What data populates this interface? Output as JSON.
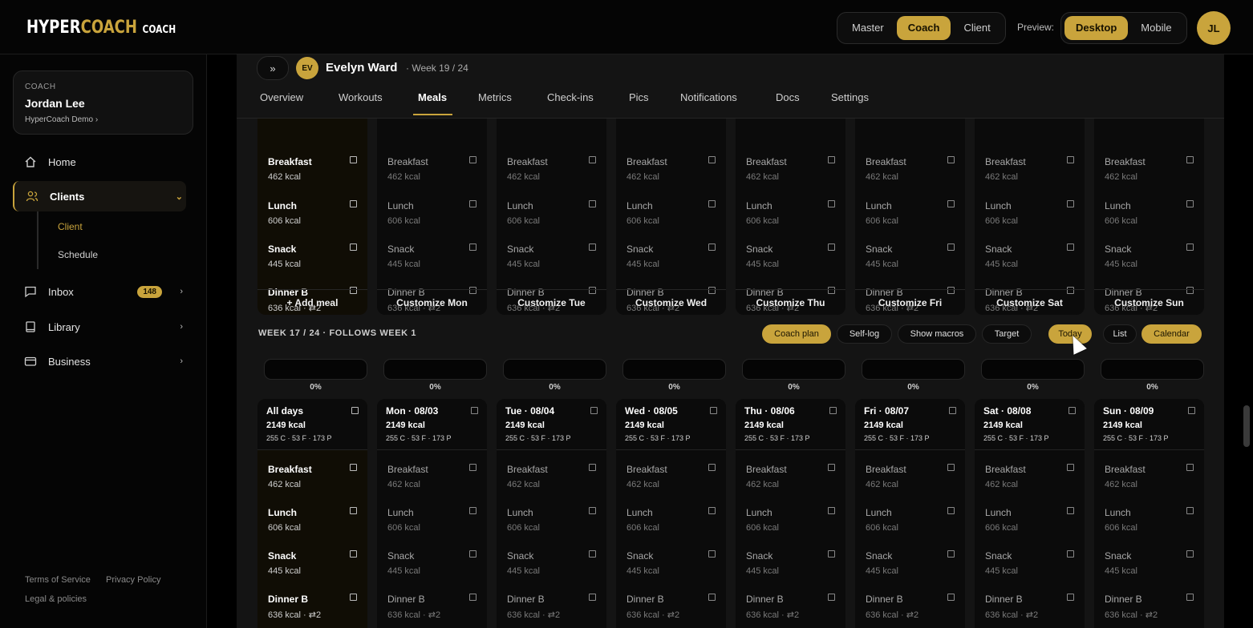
{
  "brand": {
    "name_white": "HYPER",
    "name_gold": "COACH",
    "tag": "COACH"
  },
  "modes": [
    "Master",
    "Coach",
    "Client"
  ],
  "active_mode": "Coach",
  "preview": {
    "label": "Preview:",
    "options": [
      "Desktop",
      "Mobile"
    ],
    "active": "Desktop"
  },
  "user": {
    "initials": "JL"
  },
  "coach_card": {
    "kicker": "COACH",
    "name": "Jordan Lee",
    "org": "HyperCoach Demo ›"
  },
  "sidebar": {
    "items": [
      {
        "label": "Home",
        "icon": "home-icon"
      },
      {
        "label": "Clients",
        "icon": "users-icon"
      },
      {
        "label": "Inbox",
        "icon": "chat-icon",
        "badge": "148"
      },
      {
        "label": "Library",
        "icon": "book-icon"
      },
      {
        "label": "Business",
        "icon": "card-icon"
      }
    ],
    "sub": [
      "Client",
      "Schedule"
    ],
    "footer": {
      "terms": "Terms of Service",
      "privacy": "Privacy Policy",
      "legal": "Legal & policies"
    }
  },
  "client": {
    "initials": "EV",
    "name": "Evelyn Ward",
    "week": "· Week 19 / 24",
    "expand": "»"
  },
  "tabs": [
    "Overview",
    "Workouts",
    "Meals",
    "Metrics",
    "Check-ins",
    "Pics",
    "Notifications",
    "Docs",
    "Settings"
  ],
  "active_tab": "Meals",
  "meals": [
    {
      "name": "Breakfast",
      "kcal": "462 kcal"
    },
    {
      "name": "Lunch",
      "kcal": "606 kcal"
    },
    {
      "name": "Snack",
      "kcal": "445 kcal"
    },
    {
      "name": "Dinner B",
      "kcal": "636 kcal · ⇄2"
    }
  ],
  "week1": {
    "buttons": [
      "+ Add meal",
      "Customize Mon",
      "Customize Tue",
      "Customize Wed",
      "Customize Thu",
      "Customize Fri",
      "Customize Sat",
      "Customize Sun"
    ]
  },
  "week2": {
    "label": "WEEK 17 / 24 · FOLLOWS WEEK 1",
    "toolbar": [
      "Coach plan",
      "Self-log",
      "Show macros",
      "Target",
      "Today",
      "List",
      "Calendar"
    ],
    "toolbar_active": [
      "Coach plan",
      "Today",
      "Calendar"
    ],
    "progress": [
      "0%",
      "0%",
      "0%",
      "0%",
      "0%",
      "0%",
      "0%",
      "0%"
    ],
    "days": [
      {
        "title": "All days",
        "kcal": "2149 kcal",
        "macros": "255 C · 53 F · 173 P"
      },
      {
        "title": "Mon · 08/03",
        "kcal": "2149 kcal",
        "macros": "255 C · 53 F · 173 P"
      },
      {
        "title": "Tue · 08/04",
        "kcal": "2149 kcal",
        "macros": "255 C · 53 F · 173 P"
      },
      {
        "title": "Wed · 08/05",
        "kcal": "2149 kcal",
        "macros": "255 C · 53 F · 173 P"
      },
      {
        "title": "Thu · 08/06",
        "kcal": "2149 kcal",
        "macros": "255 C · 53 F · 173 P"
      },
      {
        "title": "Fri · 08/07",
        "kcal": "2149 kcal",
        "macros": "255 C · 53 F · 173 P"
      },
      {
        "title": "Sat · 08/08",
        "kcal": "2149 kcal",
        "macros": "255 C · 53 F · 173 P"
      },
      {
        "title": "Sun · 08/09",
        "kcal": "2149 kcal",
        "macros": "255 C · 53 F · 173 P"
      }
    ]
  },
  "colors": {
    "accent": "#c9a43c",
    "background": "#000000",
    "panel": "#141414"
  }
}
